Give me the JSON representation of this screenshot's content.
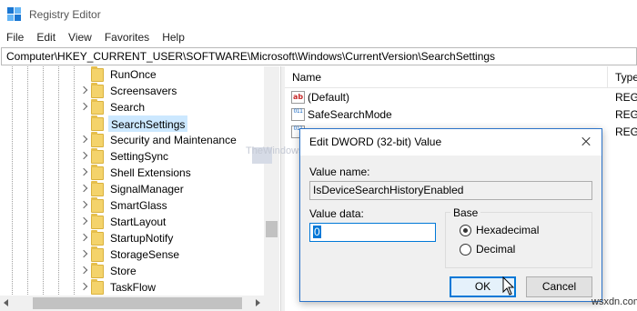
{
  "window": {
    "title": "Registry Editor"
  },
  "menu": [
    "File",
    "Edit",
    "View",
    "Favorites",
    "Help"
  ],
  "address": "Computer\\HKEY_CURRENT_USER\\SOFTWARE\\Microsoft\\Windows\\CurrentVersion\\SearchSettings",
  "tree": {
    "items": [
      {
        "label": "RunOnce",
        "expandable": false,
        "selected": false
      },
      {
        "label": "Screensavers",
        "expandable": true,
        "selected": false
      },
      {
        "label": "Search",
        "expandable": true,
        "selected": false
      },
      {
        "label": "SearchSettings",
        "expandable": false,
        "selected": true
      },
      {
        "label": "Security and Maintenance",
        "expandable": true,
        "selected": false
      },
      {
        "label": "SettingSync",
        "expandable": true,
        "selected": false
      },
      {
        "label": "Shell Extensions",
        "expandable": true,
        "selected": false
      },
      {
        "label": "SignalManager",
        "expandable": true,
        "selected": false
      },
      {
        "label": "SmartGlass",
        "expandable": true,
        "selected": false
      },
      {
        "label": "StartLayout",
        "expandable": true,
        "selected": false
      },
      {
        "label": "StartupNotify",
        "expandable": true,
        "selected": false
      },
      {
        "label": "StorageSense",
        "expandable": true,
        "selected": false
      },
      {
        "label": "Store",
        "expandable": true,
        "selected": false
      },
      {
        "label": "TaskFlow",
        "expandable": true,
        "selected": false
      }
    ]
  },
  "list": {
    "columns": {
      "name": "Name",
      "type": "Type"
    },
    "rows": [
      {
        "icon": "string-value-icon",
        "glyph": "ab",
        "name": "(Default)",
        "type": "REG_"
      },
      {
        "icon": "dword-value-icon",
        "glyph": "011",
        "name": "SafeSearchMode",
        "type": "REG_"
      },
      {
        "icon": "dword-value-icon",
        "glyph": "011",
        "name": "",
        "type": "REG_"
      }
    ]
  },
  "watermark": "TheWindowsClub",
  "dialog": {
    "title": "Edit DWORD (32-bit) Value",
    "value_name_label": "Value name:",
    "value_name": "IsDeviceSearchHistoryEnabled",
    "value_data_label": "Value data:",
    "value_data": "0",
    "base_label": "Base",
    "base_options": [
      {
        "label": "Hexadecimal",
        "selected": true
      },
      {
        "label": "Decimal",
        "selected": false
      }
    ],
    "ok_label": "OK",
    "cancel_label": "Cancel"
  },
  "site": "wsxdn.com",
  "colors": {
    "selection": "#cce8ff",
    "accent": "#0078d7",
    "folder": "#f4d36b"
  }
}
